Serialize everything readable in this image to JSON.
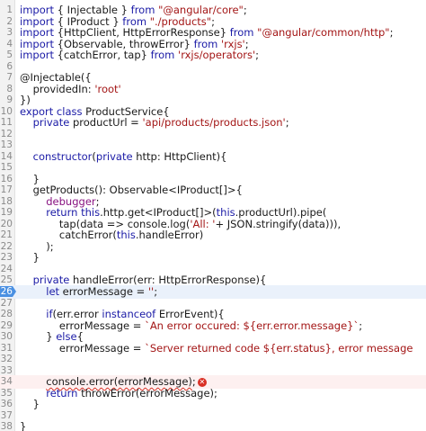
{
  "editor": {
    "language": "typescript",
    "execution_line": 26,
    "error_line": 34,
    "lines": [
      {
        "n": "1",
        "text": "import { Injectable } from \"@angular/core\";"
      },
      {
        "n": "2",
        "text": "import { IProduct } from \"./products\";"
      },
      {
        "n": "3",
        "text": "import {HttpClient, HttpErrorResponse} from \"@angular/common/http\";"
      },
      {
        "n": "4",
        "text": "import {Observable, throwError} from 'rxjs';"
      },
      {
        "n": "5",
        "text": "import {catchError, tap} from 'rxjs/operators';"
      },
      {
        "n": "6",
        "text": ""
      },
      {
        "n": "7",
        "text": "@Injectable({"
      },
      {
        "n": "8",
        "text": "    providedIn: 'root'"
      },
      {
        "n": "9",
        "text": "})"
      },
      {
        "n": "10",
        "text": "export class ProductService{"
      },
      {
        "n": "11",
        "text": "    private productUrl = 'api/products/products.json';"
      },
      {
        "n": "12",
        "text": ""
      },
      {
        "n": "13",
        "text": ""
      },
      {
        "n": "14",
        "text": "    constructor(private http: HttpClient){"
      },
      {
        "n": "15",
        "text": ""
      },
      {
        "n": "16",
        "text": "    }"
      },
      {
        "n": "17",
        "text": "    getProducts(): Observable<IProduct[]>{"
      },
      {
        "n": "18",
        "text": "        debugger;"
      },
      {
        "n": "19",
        "text": "        return this.http.get<IProduct[]>(this.productUrl).pipe("
      },
      {
        "n": "20",
        "text": "            tap(data => console.log('All: '+ JSON.stringify(data))),"
      },
      {
        "n": "21",
        "text": "            catchError(this.handleError)"
      },
      {
        "n": "22",
        "text": "        );"
      },
      {
        "n": "23",
        "text": "    }"
      },
      {
        "n": "24",
        "text": ""
      },
      {
        "n": "25",
        "text": "    private handleError(err: HttpErrorResponse){"
      },
      {
        "n": "26",
        "text": "        let errorMessage = '';"
      },
      {
        "n": "27",
        "text": ""
      },
      {
        "n": "28",
        "text": "        if(err.error instanceof ErrorEvent){"
      },
      {
        "n": "29",
        "text": "            errorMessage = `An error occured: ${err.error.message}`;"
      },
      {
        "n": "30",
        "text": "        } else{"
      },
      {
        "n": "31",
        "text": "            errorMessage = `Server returned code ${err.status}, error message"
      },
      {
        "n": "32",
        "text": ""
      },
      {
        "n": "33",
        "text": ""
      },
      {
        "n": "34",
        "text": "        console.error(errorMessage);"
      },
      {
        "n": "35",
        "text": "        return throwError(errorMessage);"
      },
      {
        "n": "36",
        "text": "    }"
      },
      {
        "n": "37",
        "text": ""
      },
      {
        "n": "38",
        "text": "}"
      }
    ]
  }
}
